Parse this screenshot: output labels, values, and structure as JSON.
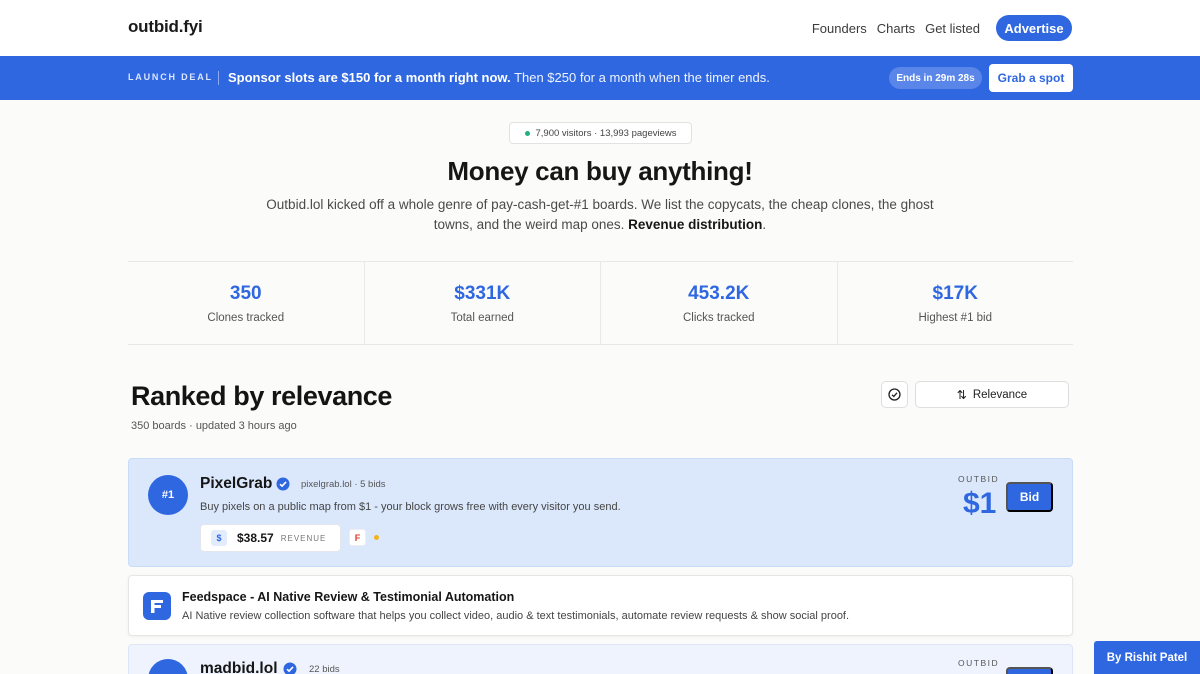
{
  "nav": {
    "brand": "outbid.fyi",
    "links": [
      "Founders",
      "Charts",
      "Get listed"
    ],
    "advertise": "Advertise"
  },
  "promo": {
    "tag": "LAUNCH DEAL",
    "bold": "Sponsor slots are $150 for a month right now.",
    "rest": " Then $250 for a month when the timer ends.",
    "timer": "Ends in 29m 28s",
    "cta": "Grab a spot"
  },
  "hero": {
    "visitors": "7,900 visitors · 13,993 pageviews",
    "title": "Money can buy anything!",
    "subtitle": "Outbid.lol kicked off a whole genre of pay-cash-get-#1 boards. We list the copycats, the cheap clones, the ghost towns, and the weird map ones. ",
    "subtitle_link": "Revenue distribution",
    "subtitle_end": "."
  },
  "stats": [
    {
      "value": "350",
      "label": "Clones tracked"
    },
    {
      "value": "$331K",
      "label": "Total earned"
    },
    {
      "value": "453.2K",
      "label": "Clicks tracked"
    },
    {
      "value": "$17K",
      "label": "Highest #1 bid"
    }
  ],
  "section": {
    "title": "Ranked by relevance",
    "meta": "350 boards · updated 3 hours ago",
    "sort_label": "Relevance"
  },
  "listings": [
    {
      "rank": "#1",
      "name": "PixelGrab",
      "meta": "pixelgrab.lol · 5 bids",
      "description": "Buy pixels on a public map from $1 - your block grows free with every visitor you send.",
      "revenue": "$38.57",
      "revenue_label": "REVENUE",
      "revenue_icon": "$",
      "badge": "F",
      "outbid_label": "OUTBID",
      "outbid_value": "$1",
      "bid_label": "Bid"
    },
    {
      "name": "madbid.lol",
      "meta": "22 bids",
      "outbid_label": "OUTBID"
    }
  ],
  "sponsor": {
    "name": "Feedspace - AI Native Review & Testimonial Automation",
    "description": "AI Native review collection software that helps you collect video, audio & text testimonials, automate review requests & show social proof."
  },
  "author": "By Rishit Patel",
  "colors": {
    "accent": "#2f67e0",
    "card_highlight": "#dbe8fc",
    "live_dot": "#22b07d"
  }
}
